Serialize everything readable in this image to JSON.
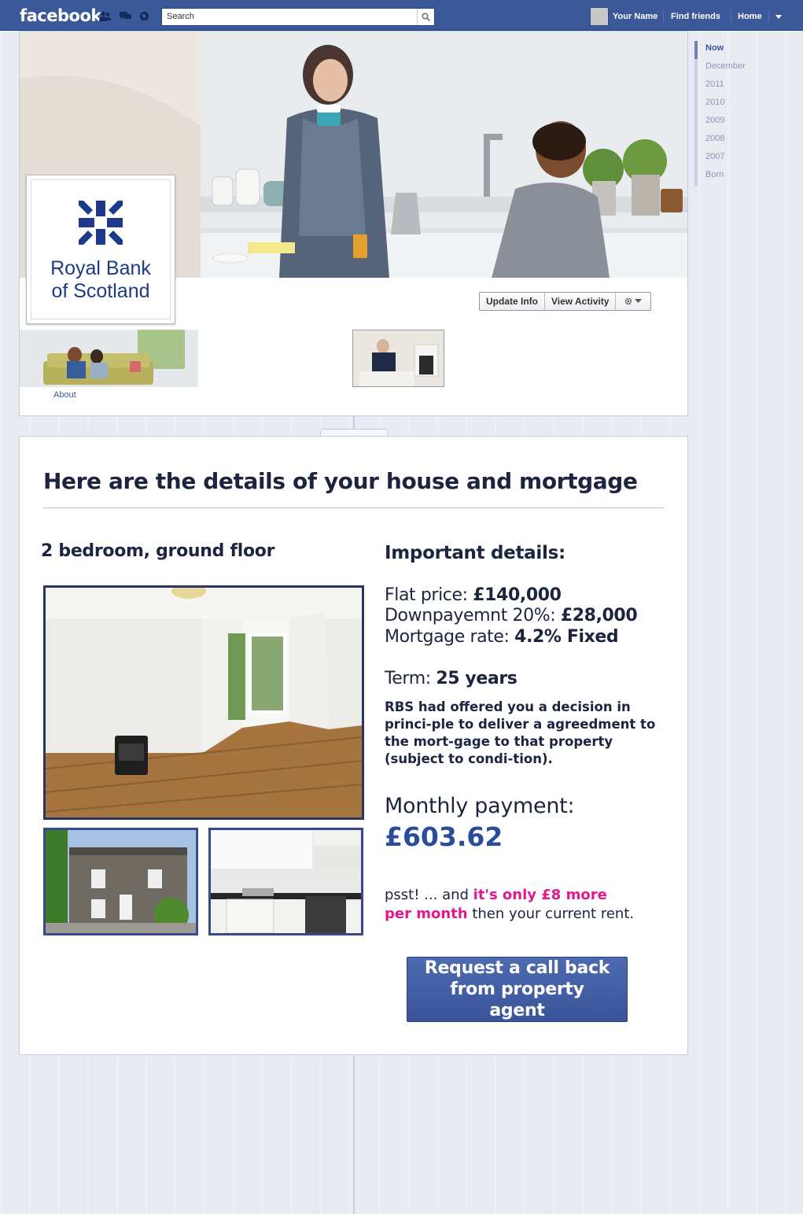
{
  "topbar": {
    "logo": "facebook",
    "search_placeholder": "Search",
    "user_name": "Your Name",
    "find_friends": "Find friends",
    "home": "Home",
    "icons": [
      "friends-icon",
      "messages-icon",
      "notifications-icon",
      "search-icon",
      "dropdown-arrow-icon"
    ]
  },
  "profile": {
    "brand_line1": "Royal Bank",
    "brand_line2": "of Scotland",
    "update_info": "Update Info",
    "view_activity": "View Activity",
    "about": "About"
  },
  "timeline_nav": {
    "items": [
      "Now",
      "December",
      "2011",
      "2010",
      "2009",
      "2008",
      "2007",
      "Born"
    ],
    "active": "Now"
  },
  "content": {
    "headline": "Here are the details of your house and mortgage",
    "property_summary": "2 bedroom, ground floor",
    "important_title": "Important details:",
    "flat_price_label": "Flat price: ",
    "flat_price_value": "£140,000",
    "downpayment_label": "Downpayemnt 20%: ",
    "downpayment_value": "£28,000",
    "rate_label": "Mortgage rate: ",
    "rate_value": "4.2% Fixed",
    "term_label": "Term: ",
    "term_value": "25 years",
    "decision_text": "RBS had offered you a decision in princi-ple to deliver a agreedment to the mort-gage to that property (subject to condi-tion).",
    "monthly_label": "Monthly payment:",
    "monthly_value": "£603.62",
    "psst_prefix": "psst! ... and ",
    "psst_highlight": "it's only £8 more per month",
    "psst_suffix": "  then your current rent.",
    "cta_label": "Request a call back from property agent"
  },
  "colors": {
    "facebook_blue": "#3b5998",
    "brand_navy": "#1c2440",
    "payment_blue": "#2b4c9b",
    "highlight_pink": "#e5168f",
    "cta_blue": "#4262a8"
  }
}
